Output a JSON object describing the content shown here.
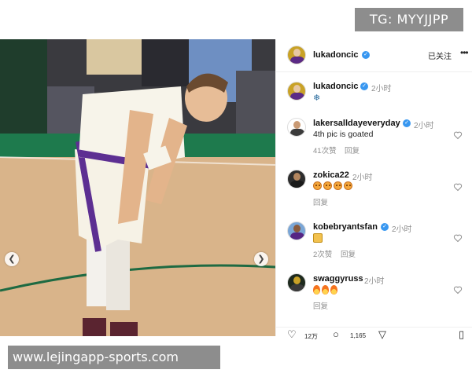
{
  "watermarks": {
    "top": "TG: MYYJJPP",
    "bottom": "www.lejingapp-sports.com"
  },
  "post": {
    "author": "lukadoncic",
    "follow_label": "已关注",
    "caption": {
      "username": "lukadoncic",
      "time": "2小时",
      "emoji": "❄"
    }
  },
  "comments": [
    {
      "username": "lakersalldayeveryday",
      "verified": true,
      "time": "2小时",
      "text": "4th pic is goated",
      "likes": "41次赞",
      "reply": "回复"
    },
    {
      "username": "zokica22",
      "verified": false,
      "time": "2小时",
      "text": "",
      "emoji": "heart-eyes-x4",
      "likes": "",
      "reply": "回复"
    },
    {
      "username": "kobebryantsfan",
      "verified": true,
      "time": "2小时",
      "text": "",
      "emoji": "raised-hands",
      "likes": "2次赞",
      "reply": "回复"
    },
    {
      "username": "swaggyruss",
      "verified": false,
      "time": "2小时",
      "text": "",
      "emoji": "fire-x3",
      "likes": "",
      "reply": "回复"
    }
  ],
  "actions": {
    "likes_count": "12万",
    "comments_count": "1,165"
  },
  "colors": {
    "verified": "#3897f0",
    "secondary_text": "#8e8e8e",
    "watermark_bg": "#8d8d8d"
  }
}
